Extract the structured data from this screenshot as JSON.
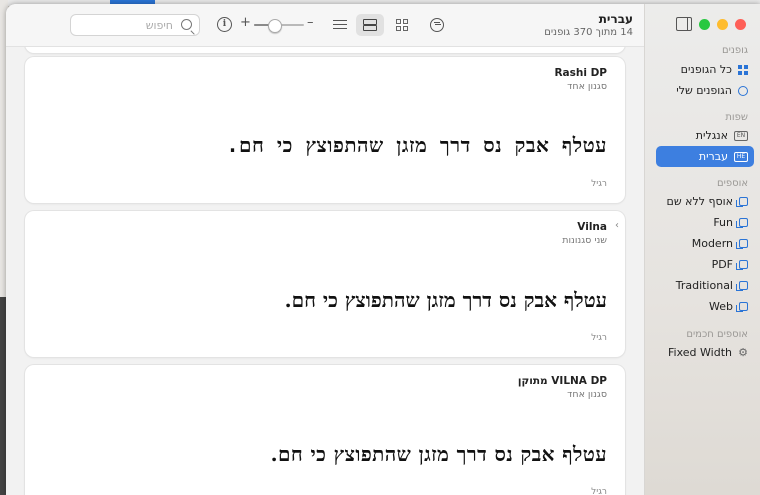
{
  "window": {
    "title": "עברית",
    "subtitle": "14 מתוך 370 גופנים"
  },
  "toolbar": {
    "search_placeholder": "חיפוש",
    "size_minus": "–",
    "size_plus": "+",
    "size_value": 0.4,
    "info_glyph": "i"
  },
  "sidebar": {
    "sections": {
      "fonts": "גופנים",
      "languages": "שפות",
      "collections": "אוספים",
      "smart": "אוספים חכמים"
    },
    "fonts_items": [
      {
        "label": "כל הגופנים",
        "icon": "grid-icon"
      },
      {
        "label": "הגופנים שלי",
        "icon": "person-icon"
      }
    ],
    "language_items": [
      {
        "label": "אנגלית",
        "badge": "EN",
        "selected": false
      },
      {
        "label": "עברית",
        "badge": "HE",
        "selected": true
      }
    ],
    "collection_items": [
      {
        "label": "אוסף ללא שם"
      },
      {
        "label": "Fun"
      },
      {
        "label": "Modern"
      },
      {
        "label": "PDF"
      },
      {
        "label": "Traditional"
      },
      {
        "label": "Web"
      }
    ],
    "smart_items": [
      {
        "label": "Fixed Width"
      }
    ]
  },
  "fonts": [
    {
      "name": "Rashi DP",
      "styles": "סגנון אחד",
      "sample": "עטלף אבק נס דרך מזגן שהתפוצץ כי חם.",
      "style_label": "רגיל"
    },
    {
      "name": "Vilna",
      "styles": "שני סגנונות",
      "sample": "עטלף אבק נס דרך מזגן שהתפוצץ כי חם.",
      "style_label": "רגיל"
    },
    {
      "name": "VILNA DP מתוקן",
      "styles": "סגנון אחד",
      "sample": "עטלף אבק נס דרך מזגן שהתפוצץ כי חם.",
      "style_label": "רגיל"
    }
  ],
  "colors": {
    "accent": "#3d7fe0",
    "sidebar_bg": "#e8e6e3"
  }
}
